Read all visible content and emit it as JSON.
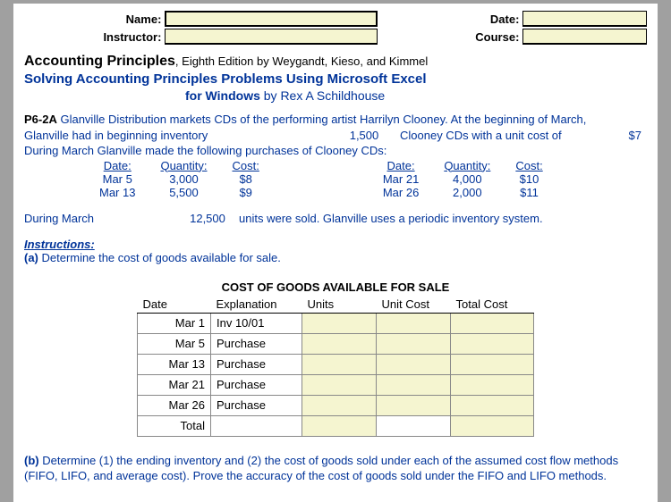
{
  "header": {
    "name_label": "Name:",
    "date_label": "Date:",
    "instructor_label": "Instructor:",
    "course_label": "Course:"
  },
  "titles": {
    "book": "Accounting Principles",
    "book_sub": ", Eighth Edition by Weygandt, Kieso, and Kimmel",
    "line2": "Solving Accounting Principles Problems Using Microsoft Excel",
    "line3_bold": "for Windows",
    "line3_rest": " by Rex A Schildhouse"
  },
  "problem": {
    "code": "P6-2A",
    "intro1": " Glanville Distribution markets CDs of the performing artist Harrilyn Clooney. At the beginning of March,",
    "intro2a": "Glanville had in beginning inventory",
    "begin_qty": "1,500",
    "intro2b": "Clooney CDs with a unit cost of",
    "begin_cost": "$7",
    "intro3": "During March Glanville made the following purchases of Clooney CDs:",
    "headers": {
      "date": "Date:",
      "qty": "Quantity:",
      "cost": "Cost:"
    },
    "left_rows": [
      {
        "date": "Mar 5",
        "qty": "3,000",
        "cost": "$8"
      },
      {
        "date": "Mar 13",
        "qty": "5,500",
        "cost": "$9"
      }
    ],
    "right_rows": [
      {
        "date": "Mar 21",
        "qty": "4,000",
        "cost": "$10"
      },
      {
        "date": "Mar 26",
        "qty": "2,000",
        "cost": "$11"
      }
    ],
    "during_label": "During March",
    "units_sold": "12,500",
    "units_rest": "units were sold. Glanville uses a periodic inventory system."
  },
  "instructions": {
    "heading": "Instructions:",
    "part_a": "(a)",
    "part_a_text": " Determine the cost of goods available for sale."
  },
  "cogs": {
    "title": "COST OF GOODS AVAILABLE FOR SALE",
    "headers": {
      "date": "Date",
      "expl": "Explanation",
      "units": "Units",
      "unitcost": "Unit Cost",
      "total": "Total Cost"
    },
    "rows": [
      {
        "date": "Mar 1",
        "expl": "Inv 10/01"
      },
      {
        "date": "Mar 5",
        "expl": "Purchase"
      },
      {
        "date": "Mar 13",
        "expl": "Purchase"
      },
      {
        "date": "Mar 21",
        "expl": "Purchase"
      },
      {
        "date": "Mar 26",
        "expl": "Purchase"
      },
      {
        "date": "Total",
        "expl": ""
      }
    ]
  },
  "part_b": {
    "label": "(b)",
    "text": " Determine (1) the ending inventory and (2) the cost of goods sold under each of the assumed cost flow methods (FIFO, LIFO, and average cost). Prove the accuracy of the cost of goods sold under the FIFO and LIFO methods."
  }
}
